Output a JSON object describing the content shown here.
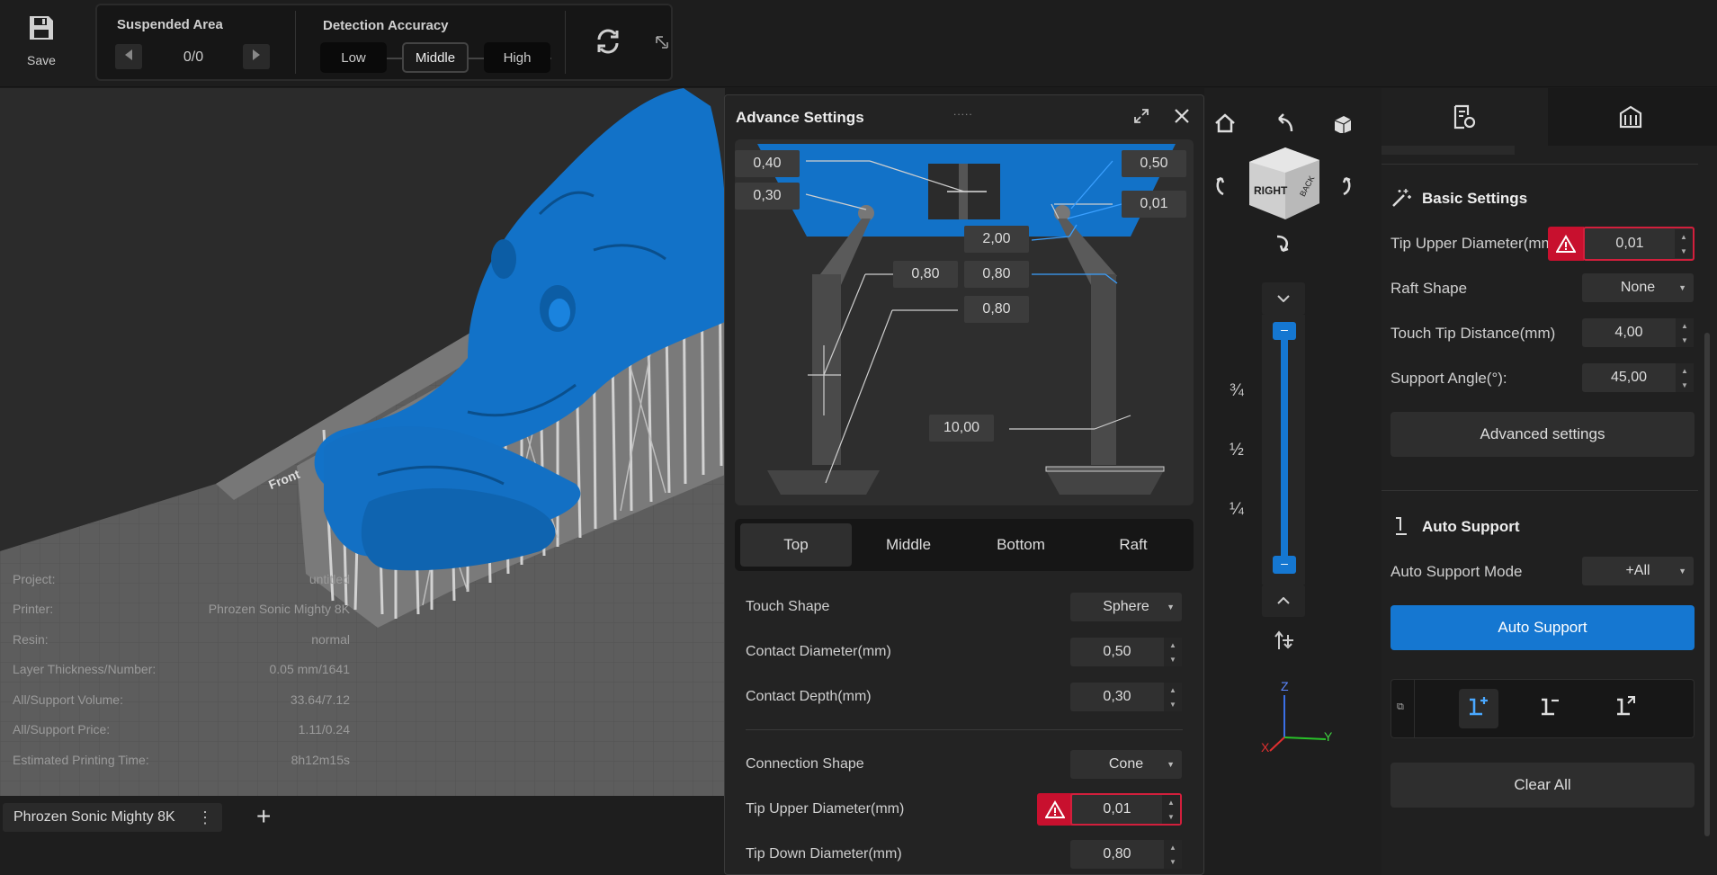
{
  "toolbar": {
    "save_label": "Save",
    "detection": {
      "suspended_area_title": "Suspended Area",
      "counter": "0/0",
      "accuracy_title": "Detection Accuracy",
      "levels": [
        "Low",
        "Middle",
        "High"
      ],
      "selected": "Middle"
    }
  },
  "project_info": [
    {
      "label": "Project:",
      "value": "untitled"
    },
    {
      "label": "Printer:",
      "value": "Phrozen Sonic Mighty 8K"
    },
    {
      "label": "Resin:",
      "value": "normal"
    },
    {
      "label": "Layer Thickness/Number:",
      "value": "0.05 mm/1641"
    },
    {
      "label": "All/Support Volume:",
      "value": "33.64/7.12"
    },
    {
      "label": "All/Support Price:",
      "value": "1.11/0.24"
    },
    {
      "label": "Estimated Printing Time:",
      "value": "8h12m15s"
    }
  ],
  "bottom": {
    "printer_tab": "Phrozen Sonic Mighty 8K",
    "add_label": "+"
  },
  "plate_label": "Front",
  "advance": {
    "title": "Advance Settings",
    "drag_handle": ".....",
    "diagram_values": [
      "0,40",
      "0,30",
      "0,50",
      "0,01",
      "2,00",
      "0,80",
      "0,80",
      "0,80",
      "10,00"
    ],
    "tabs": [
      "Top",
      "Middle",
      "Bottom",
      "Raft"
    ],
    "active_tab": "Top",
    "rows": [
      {
        "label": "Touch Shape",
        "value": "Sphere",
        "type": "dropdown"
      },
      {
        "label": "Contact Diameter(mm)",
        "value": "0,50",
        "type": "spin"
      },
      {
        "label": "Contact Depth(mm)",
        "value": "0,30",
        "type": "spin"
      },
      {
        "label": "Connection Shape",
        "value": "Cone",
        "type": "dropdown"
      },
      {
        "label": "Tip Upper Diameter(mm)",
        "value": "0,01",
        "type": "spin",
        "error": true
      },
      {
        "label": "Tip Down Diameter(mm)",
        "value": "0,80",
        "type": "spin"
      }
    ]
  },
  "view_cube": {
    "front_face": "RIGHT",
    "side_face": "BACK"
  },
  "slider": {
    "marks": [
      "¾",
      "½",
      "¼"
    ],
    "upper": 1.0,
    "lower": 0.0
  },
  "axes": {
    "x": "X",
    "y": "Y",
    "z": "Z"
  },
  "right_panel": {
    "basic_title": "Basic Settings",
    "tip_upper_label": "Tip Upper Diameter(mm)",
    "tip_upper_value": "0,01",
    "raft_shape_label": "Raft Shape",
    "raft_shape_value": "None",
    "touch_tip_label": "Touch Tip Distance(mm)",
    "touch_tip_value": "4,00",
    "support_angle_label": "Support Angle(°):",
    "support_angle_value": "45,00",
    "advanced_btn": "Advanced settings",
    "auto_title": "Auto Support",
    "auto_mode_label": "Auto Support Mode",
    "auto_mode_value": "+All",
    "auto_btn": "Auto Support",
    "clear_btn": "Clear All"
  },
  "colors": {
    "accent": "#1577d1",
    "model": "#1272c8",
    "error": "#c8102e",
    "support": "#c8c8c8"
  }
}
